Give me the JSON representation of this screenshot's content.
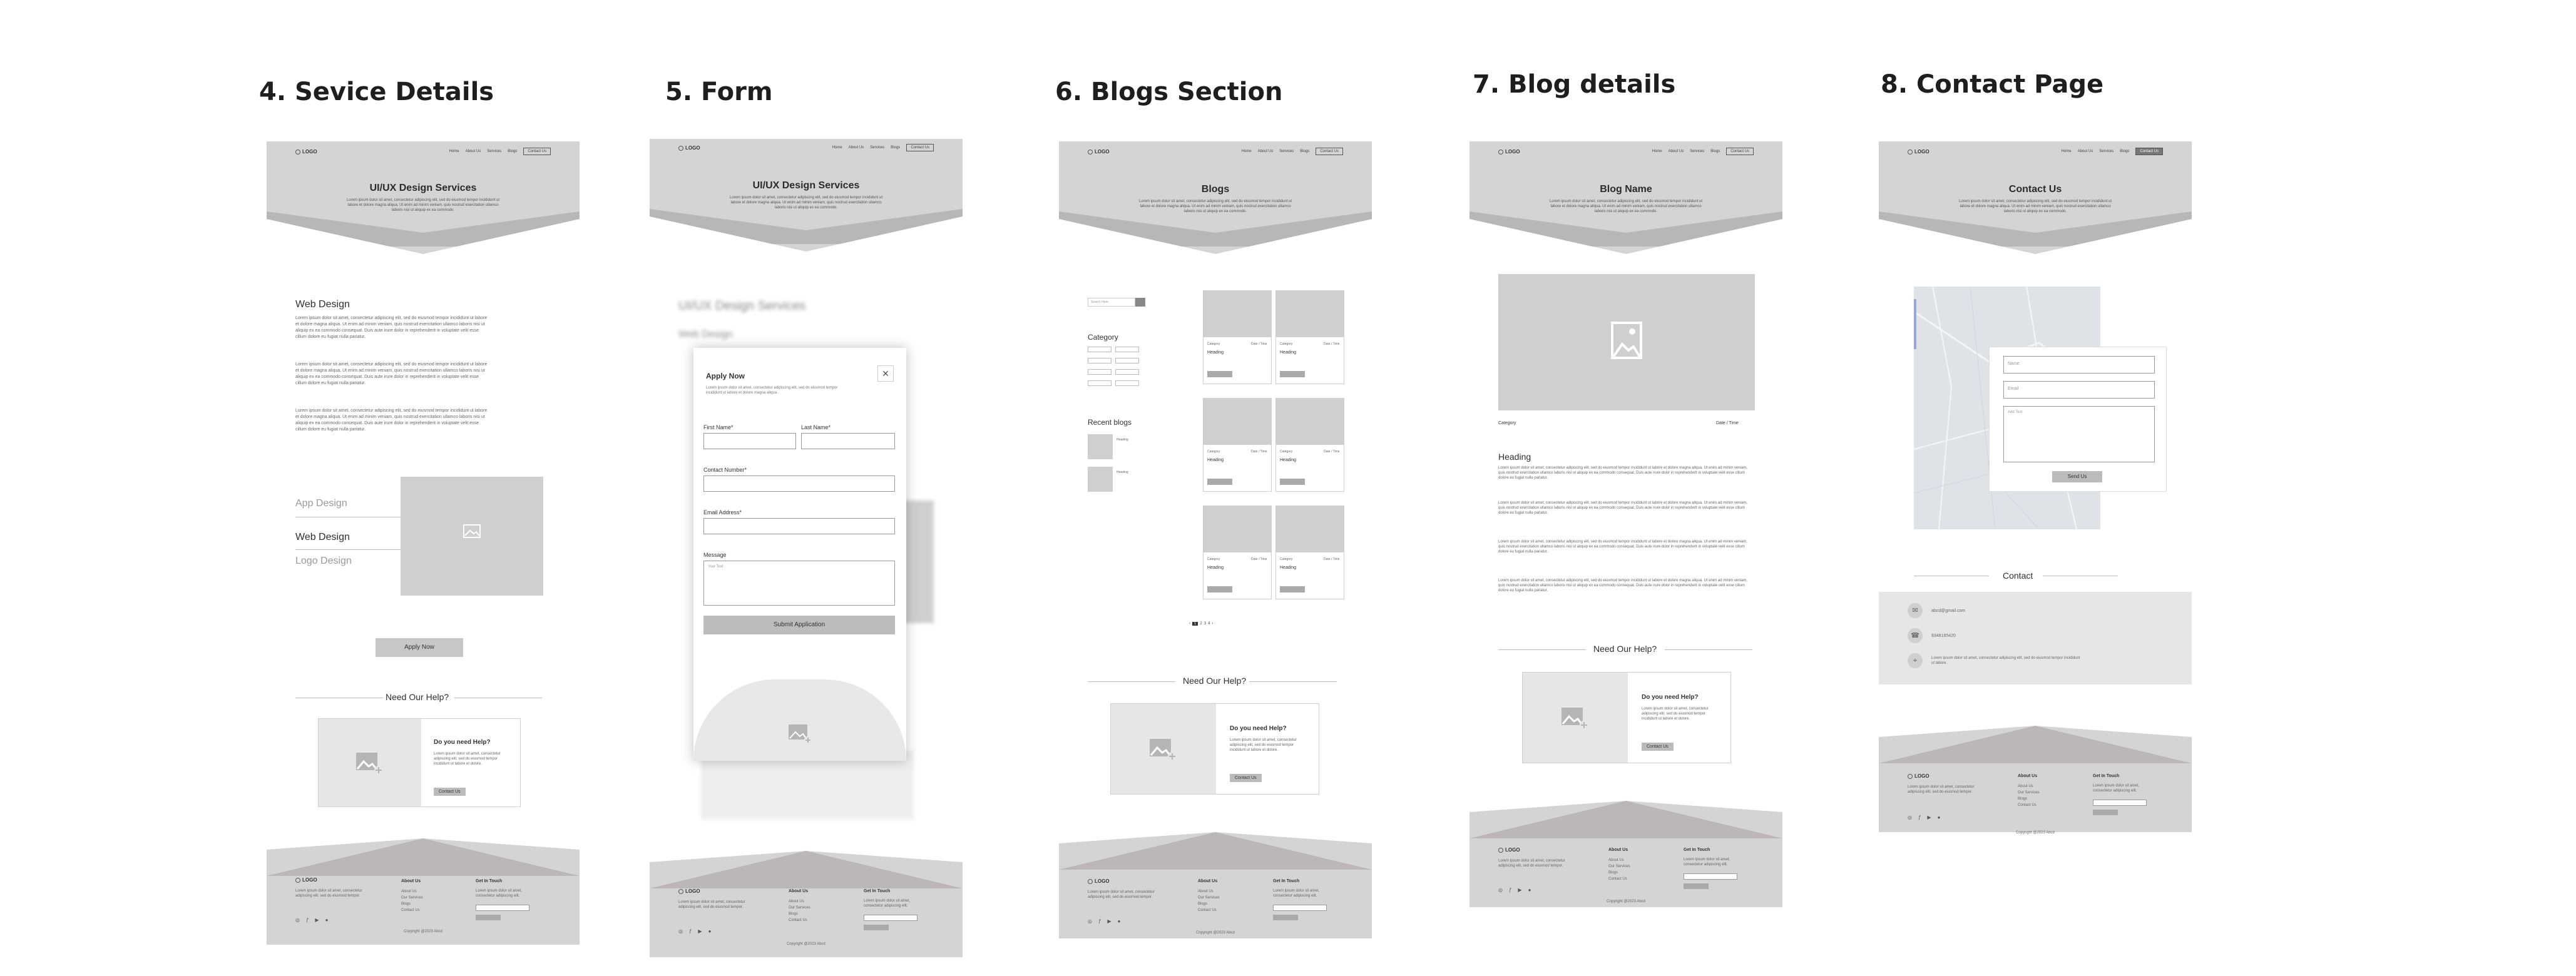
{
  "sections": [
    {
      "title": "4. Sevice Details"
    },
    {
      "title": "5. Form"
    },
    {
      "title": "6. Blogs Section"
    },
    {
      "title": "7. Blog details"
    },
    {
      "title": "8. Contact Page"
    }
  ],
  "nav": {
    "logo": "LOGO",
    "links": [
      "Home",
      "About Us",
      "Services",
      "Blogs"
    ],
    "cta": "Contact Us"
  },
  "heroes": {
    "service": "UI/UX Design Services",
    "form": "UI/UX Design Services",
    "blogs": "Blogs",
    "blog_details": "Blog Name",
    "contact": "Contact Us"
  },
  "hero_sub": "Lorem ipsum dolor sit amet, consectetur adipiscing elit, sed do eiusmod tempor incididunt ut labore et dolore magna aliqua. Ut enim ad minim veniam, quis nostrud exercitation ullamco laboris nisi ut aliquip ex ea commodo.",
  "lorem": "Lorem ipsum dolor sit amet, consectetur adipiscing elit, sed do eiusmod tempor incididunt ut labore et dolore magna aliqua. Ut enim ad minim veniam, quis nostrud exercitation ullamco laboris nisi ut aliquip ex ea commodo consequat. Duis aute irure dolor in reprehenderit in voluptate velit esse cillum dolore eu fugiat nulla pariatur.",
  "service_details": {
    "heading": "Web Design",
    "tabs": [
      "App Design",
      "Web Design",
      "Logo Design"
    ],
    "apply_label": "Apply Now"
  },
  "help": {
    "title": "Need Our Help?",
    "card_title": "Do you need Help?",
    "card_text": "Lorem ipsum dolor sit amet, consectetur adipiscing elit, sed do eiusmod tempor incididunt ut labore et dolore.",
    "card_btn": "Contact Us"
  },
  "form": {
    "blur_heading": "UI/UX Design Services",
    "blur_sub": "Web Design",
    "modal_title": "Apply Now",
    "modal_text": "Lorem ipsum dolor sit amet, consectetur adipiscing elit, sed do eiusmod tempor incididunt ut labore et dolore magna aliqua.",
    "first_name": "First Name*",
    "last_name": "Last Name*",
    "contact": "Contact Number*",
    "email": "Email Address*",
    "message": "Message",
    "message_ph": "Your Text",
    "submit": "Submit Application"
  },
  "blogs": {
    "search_ph": "Search Here",
    "category": "Category",
    "recent": "Recent blogs",
    "card_heading": "Heading",
    "card_cat": "Category",
    "card_date": "Date / Time",
    "card_btn": "Explore",
    "pages": [
      "1",
      "2",
      "3",
      "4"
    ]
  },
  "blog_details": {
    "category": "Category",
    "date": "Date / Time",
    "heading": "Heading"
  },
  "contact": {
    "name_ph": "Name",
    "email_ph": "Email",
    "text_ph": "Add Text",
    "send": "Send Us",
    "section_title": "Contact",
    "email_val": "abcd@gmail.com",
    "phone_val": "9348165420",
    "address": "Lorem ipsum dolor sit amet, consectetur adipiscing elit, sed do eiusmod tempor incididunt ut labore."
  },
  "footer": {
    "about_title": "About Us",
    "about_links": [
      "About Us",
      "Our Services",
      "Blogs",
      "Contact Us"
    ],
    "touch_title": "Get In Touch",
    "touch_text": "Lorem ipsum dolor sit amet, consectetur adipiscing elit.",
    "desc": "Lorem ipsum dolor sit amet, consectetur adipiscing elit, sed do eiusmod tempor.",
    "copyright": "Copyright @2023 Abcd"
  },
  "colors": {
    "hero_bg": "#d4d4d4",
    "band": "#b9b6b6",
    "placeholder": "#cfcfcf",
    "button": "#c7c7c7"
  }
}
